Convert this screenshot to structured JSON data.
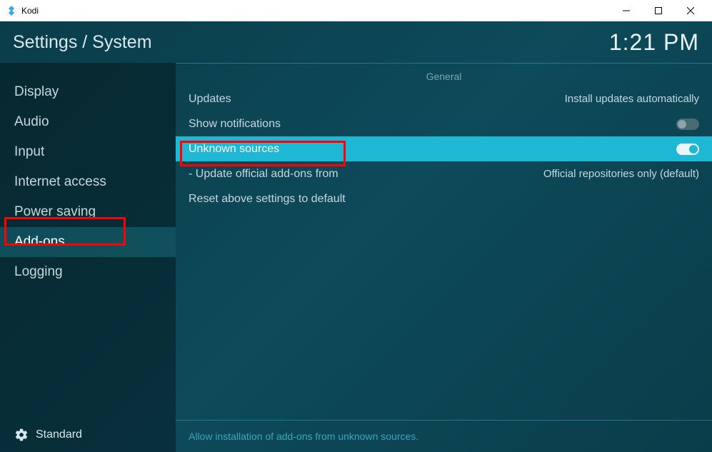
{
  "window": {
    "title": "Kodi"
  },
  "header": {
    "breadcrumb": "Settings / System",
    "clock": "1:21 PM"
  },
  "sidebar": {
    "items": [
      {
        "label": "Display"
      },
      {
        "label": "Audio"
      },
      {
        "label": "Input"
      },
      {
        "label": "Internet access"
      },
      {
        "label": "Power saving"
      },
      {
        "label": "Add-ons"
      },
      {
        "label": "Logging"
      }
    ],
    "selected_index": 5,
    "level_label": "Standard"
  },
  "main": {
    "section_title": "General",
    "rows": {
      "updates": {
        "label": "Updates",
        "value": "Install updates automatically"
      },
      "show_notifications": {
        "label": "Show notifications"
      },
      "unknown_sources": {
        "label": "Unknown sources"
      },
      "update_official": {
        "label": "- Update official add-ons from",
        "value": "Official repositories only (default)"
      },
      "reset": {
        "label": "Reset above settings to default"
      }
    },
    "footer_help": "Allow installation of add-ons from unknown sources."
  }
}
